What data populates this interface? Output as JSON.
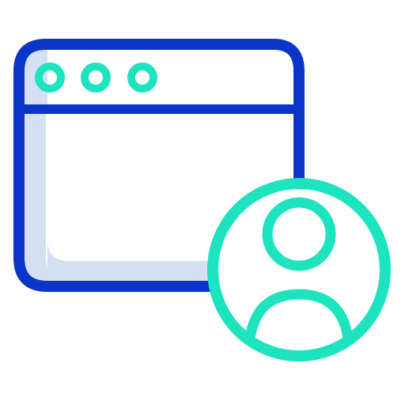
{
  "icon": {
    "name": "browser-window-user-icon",
    "colors": {
      "background": "#ffffff",
      "window_outline": "#0a35c8",
      "window_fill_accent": "#d6e0f3",
      "teal": "#1de3bf"
    },
    "parts": [
      "browser-window-icon",
      "window-dot-icon",
      "user-avatar-icon"
    ]
  }
}
